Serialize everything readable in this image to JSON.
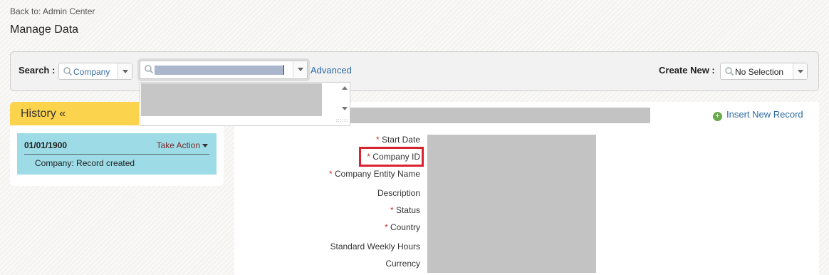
{
  "header": {
    "back_link": "Back to: Admin Center",
    "page_title": "Manage Data"
  },
  "search_bar": {
    "search_label": "Search :",
    "type_value": "Company",
    "advanced_link": "Advanced",
    "create_label": "Create New :",
    "create_value": "No Selection"
  },
  "history": {
    "title": "History «",
    "entry_date": "01/01/1900",
    "take_action": "Take Action",
    "entry_text": "Company: Record created"
  },
  "record": {
    "insert_link": "Insert New Record",
    "fields": [
      {
        "label": "Start Date",
        "required": "*"
      },
      {
        "label": "Company ID",
        "required": "*"
      },
      {
        "label": "Company Entity Name",
        "required": "*"
      },
      {
        "label": "Description",
        "required": ""
      },
      {
        "label": "Status",
        "required": "*"
      },
      {
        "label": "Country",
        "required": "*"
      },
      {
        "label": "Standard Weekly Hours",
        "required": ""
      },
      {
        "label": "Currency",
        "required": ""
      }
    ]
  },
  "colors": {
    "history_tab": "#fcd34d",
    "history_card": "#9ddce6",
    "link": "#2e6aa3",
    "required": "#c0392b",
    "highlight": "#d9232e"
  }
}
